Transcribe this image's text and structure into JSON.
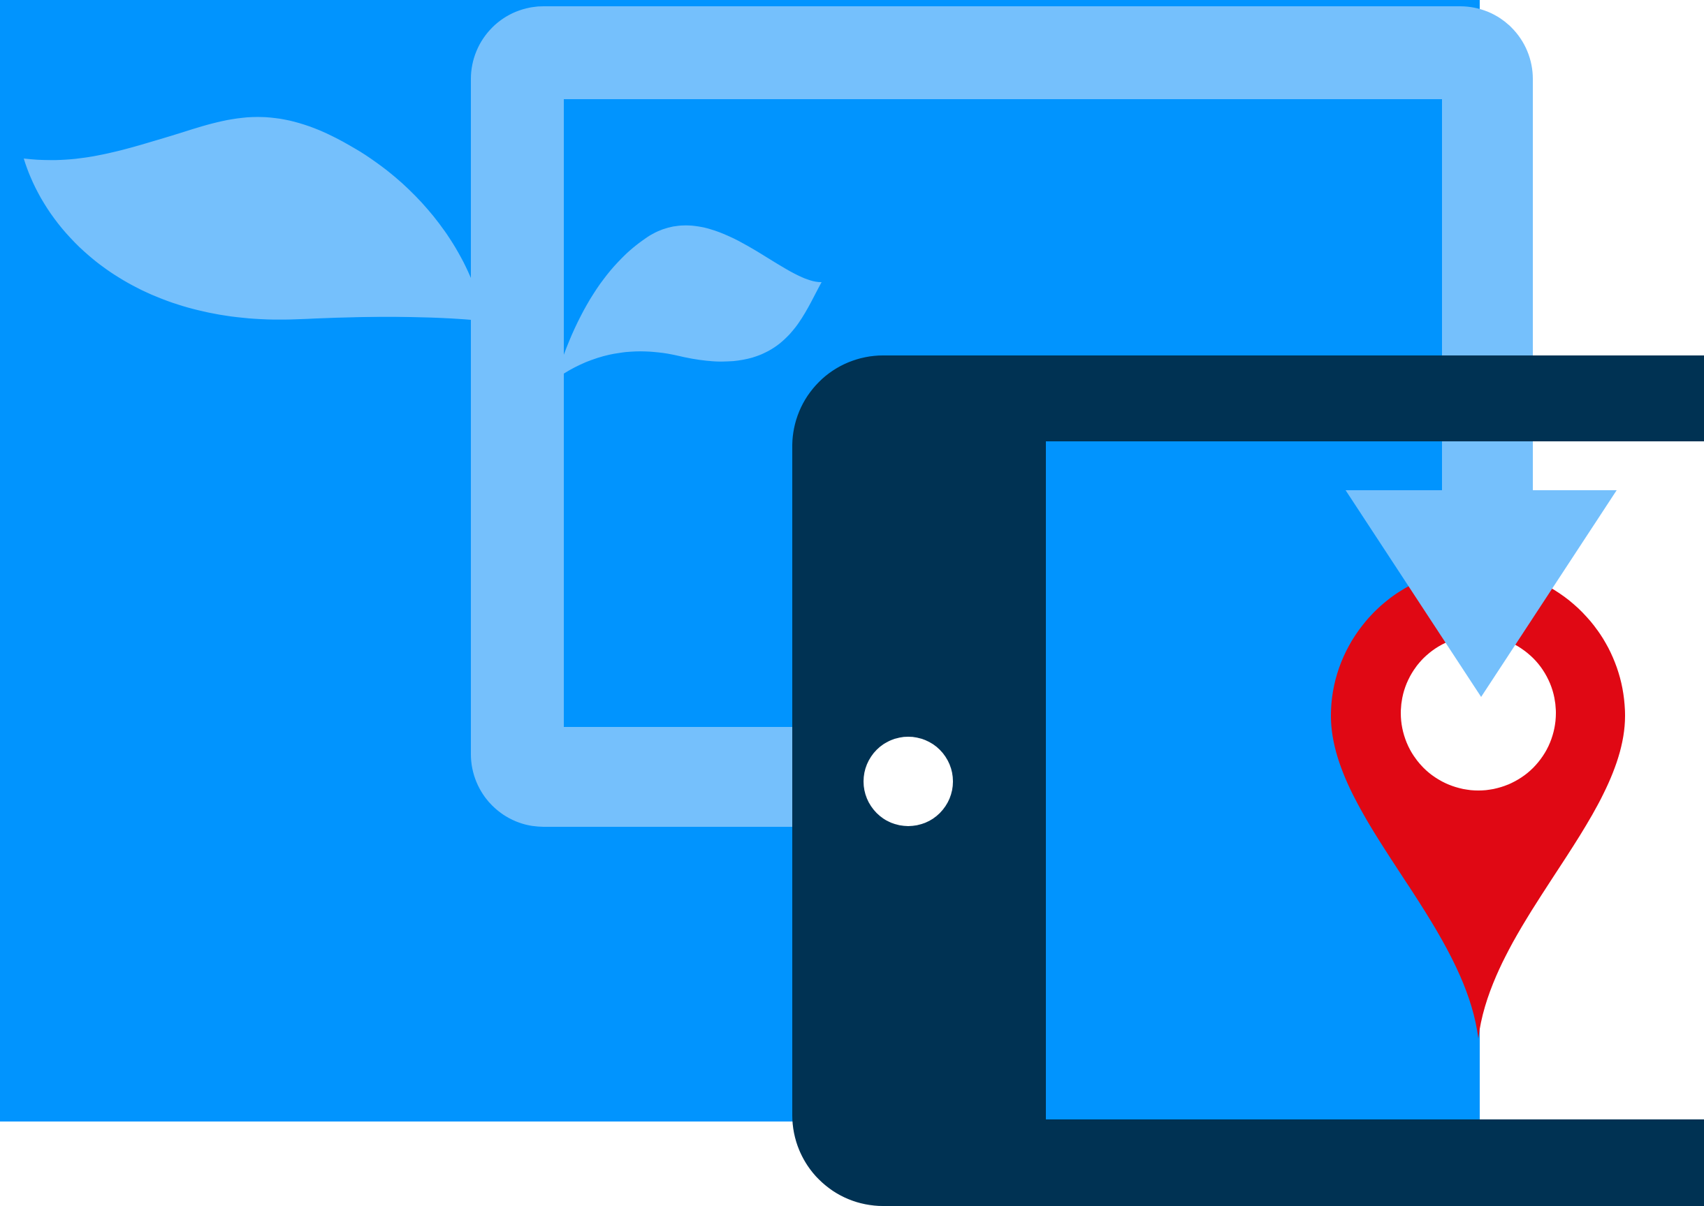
{
  "illustration": {
    "icons": [
      "sprouting-frame-icon",
      "tablet-icon",
      "home-button-icon",
      "location-pin-icon",
      "down-arrow-icon"
    ]
  },
  "colors": {
    "background": "#ffffff",
    "bright_blue": "#0194FE",
    "light_blue": "#75C0FC",
    "navy": "#003253",
    "pin_red": "#E00814",
    "white": "#ffffff"
  }
}
